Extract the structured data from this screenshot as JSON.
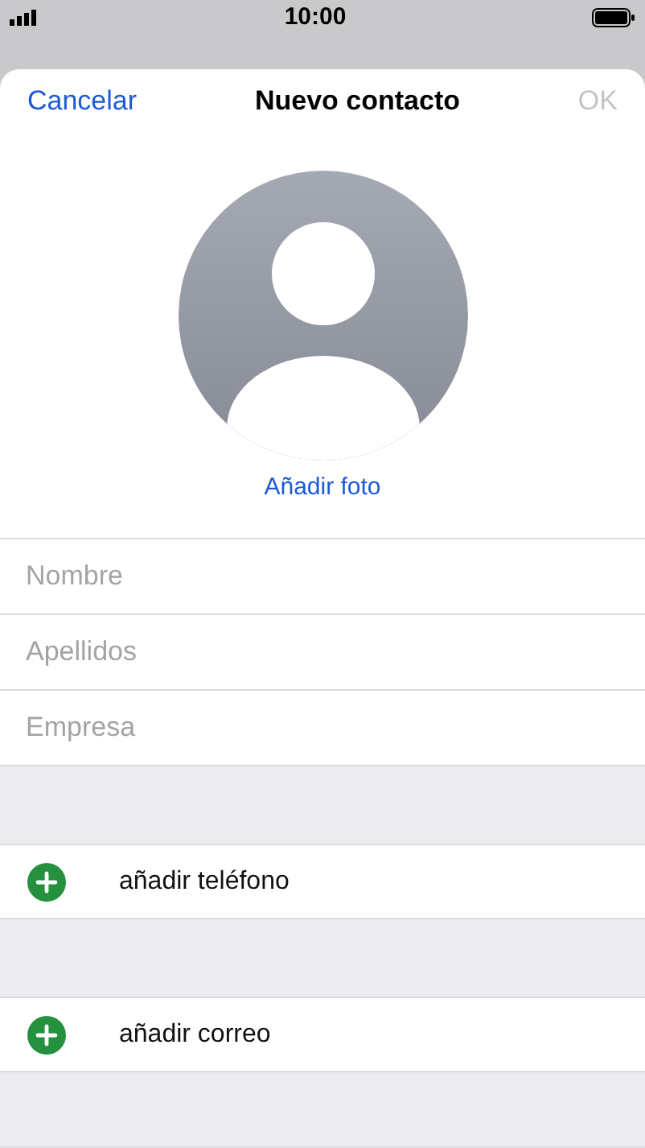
{
  "status_bar": {
    "time": "10:00"
  },
  "nav": {
    "cancel": "Cancelar",
    "title": "Nuevo contacto",
    "done": {
      "label": "OK",
      "disabled": true
    }
  },
  "photo": {
    "action": "Añadir foto"
  },
  "fields": [
    {
      "placeholder": "Nombre"
    },
    {
      "placeholder": "Apellidos"
    },
    {
      "placeholder": "Empresa"
    }
  ],
  "add_rows": [
    {
      "label": "añadir teléfono"
    },
    {
      "label": "añadir correo"
    }
  ]
}
